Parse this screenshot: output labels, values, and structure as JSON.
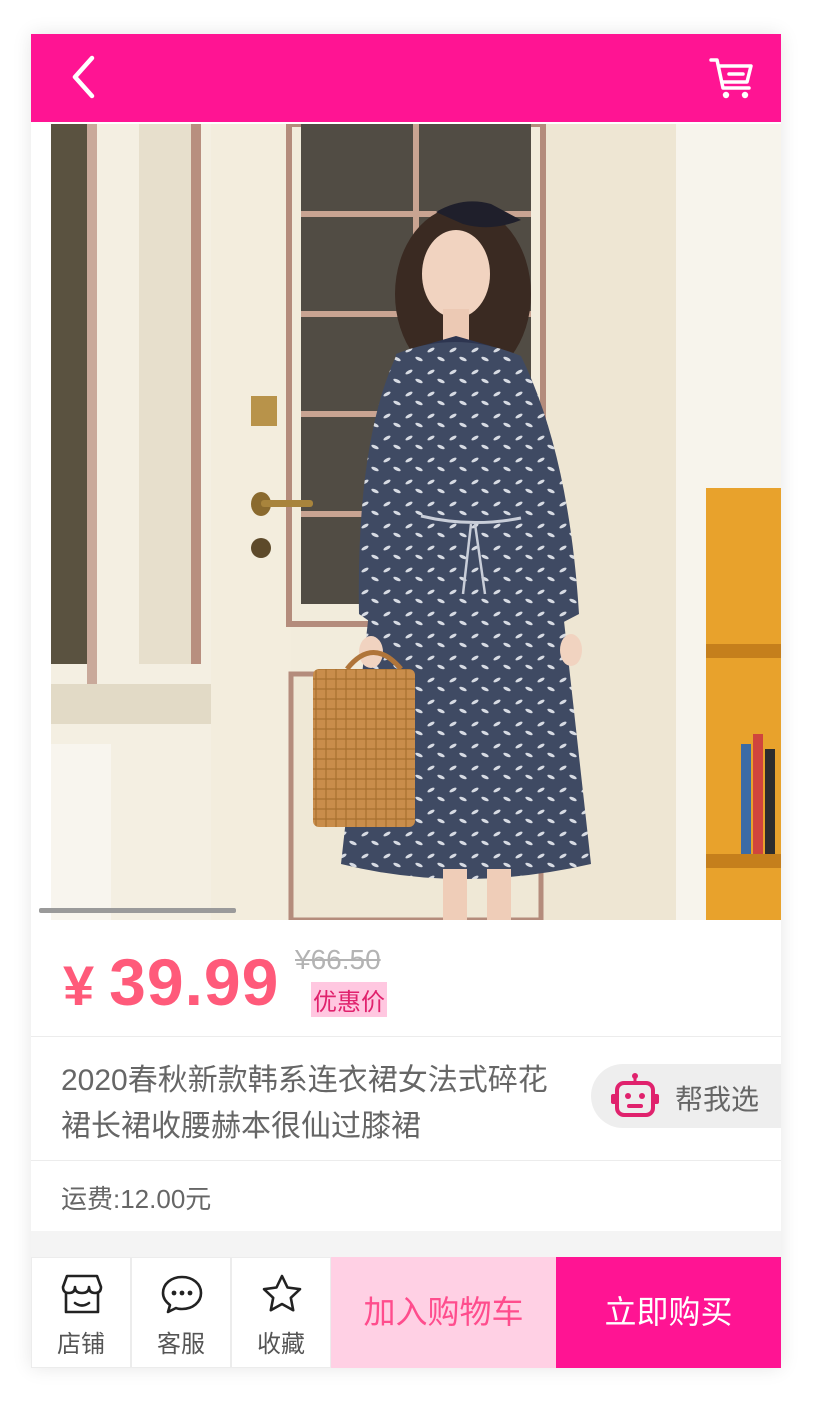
{
  "colors": {
    "brand": "#ff1493",
    "price": "#ff5a7a",
    "add_cart_bg": "#ffd0e4",
    "add_cart_text": "#ff4d8d"
  },
  "header": {
    "back_icon": "chevron-left-icon",
    "cart_icon": "shopping-cart-icon"
  },
  "product": {
    "image_alt": "product-photo",
    "carousel_progress": 0.27,
    "price_symbol": "¥",
    "price": "39.99",
    "original_price": "¥66.50",
    "discount_label": "优惠价",
    "title": "2020春秋新款韩系连衣裙女法式碎花裙长裙收腰赫本很仙过膝裙",
    "help_button": "帮我选",
    "shipping": "运费:12.00元"
  },
  "bottom_bar": {
    "items": [
      {
        "label": "店铺",
        "icon": "store-icon"
      },
      {
        "label": "客服",
        "icon": "chat-icon"
      },
      {
        "label": "收藏",
        "icon": "star-icon"
      }
    ],
    "add_to_cart": "加入购物车",
    "buy_now": "立即购买"
  }
}
